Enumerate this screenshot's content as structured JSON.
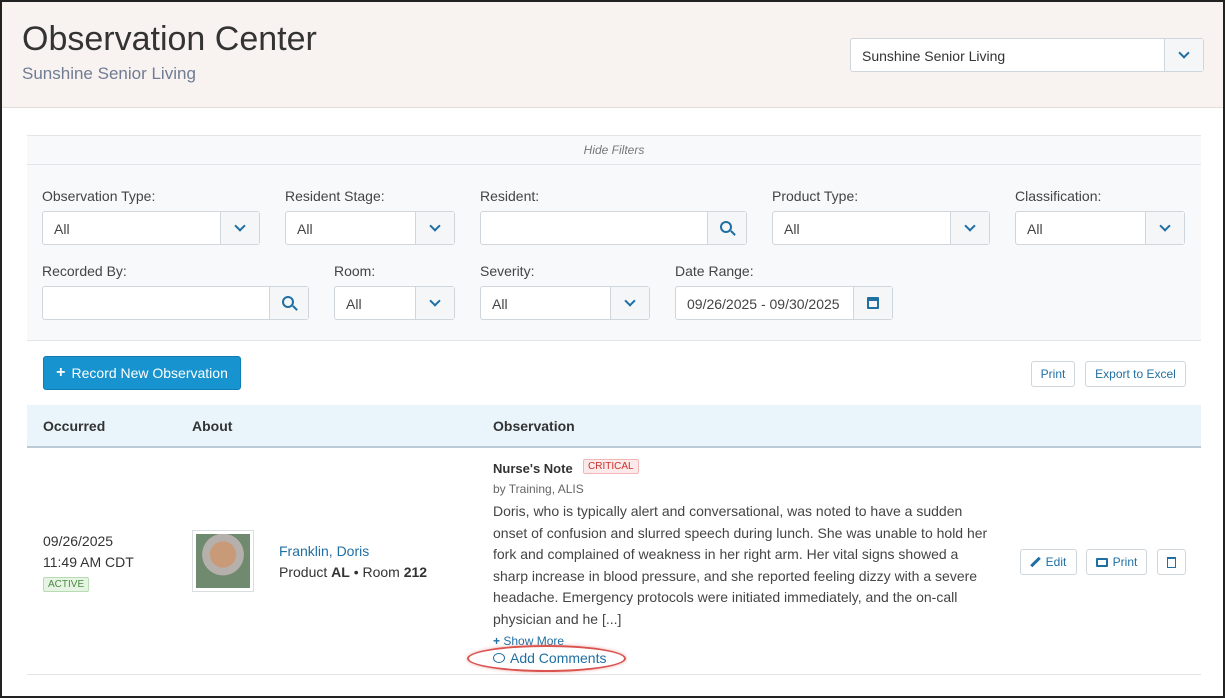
{
  "header": {
    "title": "Observation Center",
    "subtitle": "Sunshine Senior Living",
    "community_select": "Sunshine Senior Living"
  },
  "filters": {
    "hide_label": "Hide Filters",
    "observation_type": {
      "label": "Observation Type:",
      "value": "All"
    },
    "resident_stage": {
      "label": "Resident Stage:",
      "value": "All"
    },
    "resident": {
      "label": "Resident:",
      "value": ""
    },
    "product_type": {
      "label": "Product Type:",
      "value": "All"
    },
    "classification": {
      "label": "Classification:",
      "value": "All"
    },
    "recorded_by": {
      "label": "Recorded By:",
      "value": ""
    },
    "room": {
      "label": "Room:",
      "value": "All"
    },
    "severity": {
      "label": "Severity:",
      "value": "All"
    },
    "date_range": {
      "label": "Date Range:",
      "value": "09/26/2025 - 09/30/2025"
    }
  },
  "toolbar": {
    "record_label": "Record New Observation",
    "print_label": "Print",
    "export_label": "Export to Excel"
  },
  "table": {
    "columns": [
      "Occurred",
      "About",
      "Observation"
    ],
    "rows": [
      {
        "date": "09/26/2025",
        "time": "11:49 AM CDT",
        "status": "ACTIVE",
        "resident_name": "Franklin, Doris",
        "product_prefix": "Product ",
        "product": "AL",
        "room_prefix": " • Room ",
        "room": "212",
        "obs_type": "Nurse's Note",
        "severity": "CRITICAL",
        "by": "by Training, ALIS",
        "body": "Doris, who is typically alert and conversational, was noted to have a sudden onset of confusion and slurred speech during lunch. She was unable to hold her fork and complained of weakness in her right arm. Her vital signs showed a sharp increase in blood pressure, and she reported feeling dizzy with a severe headache. Emergency protocols were initiated immediately, and the on-call physician and he [...]",
        "show_more": "Show More",
        "add_comments": "Add Comments",
        "edit_label": "Edit",
        "print_label": "Print"
      }
    ]
  },
  "colors": {
    "accent": "#1793cf",
    "link": "#1f6fa3",
    "critical": "#c9302c",
    "highlight": "#d9534f"
  }
}
